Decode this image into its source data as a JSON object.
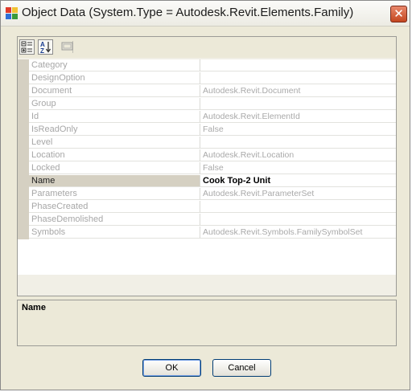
{
  "window": {
    "title": "Object Data (System.Type = Autodesk.Revit.Elements.Family)",
    "close_label": "✕"
  },
  "toolbar": {
    "buttons": [
      {
        "name": "categorized-view",
        "active": true
      },
      {
        "name": "alphabetical-view",
        "active": true,
        "label_top": "A",
        "label_bottom": "Z"
      },
      {
        "name": "property-pages",
        "active": false
      }
    ]
  },
  "properties": [
    {
      "name": "Category",
      "value": ""
    },
    {
      "name": "DesignOption",
      "value": ""
    },
    {
      "name": "Document",
      "value": "Autodesk.Revit.Document"
    },
    {
      "name": "Group",
      "value": ""
    },
    {
      "name": "Id",
      "value": "Autodesk.Revit.ElementId"
    },
    {
      "name": "IsReadOnly",
      "value": "False"
    },
    {
      "name": "Level",
      "value": ""
    },
    {
      "name": "Location",
      "value": "Autodesk.Revit.Location"
    },
    {
      "name": "Locked",
      "value": "False"
    },
    {
      "name": "Name",
      "value": "Cook Top-2 Unit",
      "selected": true
    },
    {
      "name": "Parameters",
      "value": "Autodesk.Revit.ParameterSet"
    },
    {
      "name": "PhaseCreated",
      "value": ""
    },
    {
      "name": "PhaseDemolished",
      "value": ""
    },
    {
      "name": "Symbols",
      "value": "Autodesk.Revit.Symbols.FamilySymbolSet"
    }
  ],
  "help": {
    "title": "Name"
  },
  "buttons": {
    "ok": "OK",
    "cancel": "Cancel"
  },
  "colors": {
    "window_bg": "#ece9d8",
    "selected_row": "#d5d0c2",
    "disabled_text": "#a7a7a7"
  }
}
